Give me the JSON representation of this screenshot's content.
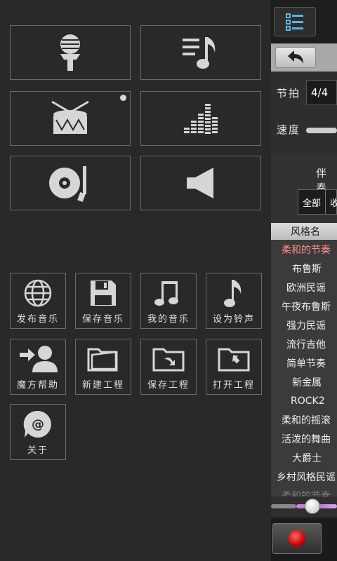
{
  "left_menu": {
    "top_buttons": [
      {
        "icon": "microphone-icon"
      },
      {
        "icon": "playlist-music-icon"
      },
      {
        "icon": "drum-icon",
        "has_indicator": true
      },
      {
        "icon": "equalizer-icon"
      },
      {
        "icon": "turntable-icon"
      },
      {
        "icon": "speaker-icon"
      }
    ],
    "actions": [
      {
        "icon": "globe-icon",
        "label": "发布音乐"
      },
      {
        "icon": "floppy-disk-icon",
        "label": "保存音乐"
      },
      {
        "icon": "double-note-icon",
        "label": "我的音乐"
      },
      {
        "icon": "single-note-icon",
        "label": "设为铃声"
      },
      {
        "icon": "user-arrow-icon",
        "label": "魔方帮助"
      },
      {
        "icon": "open-folder-icon",
        "label": "新建工程"
      },
      {
        "icon": "folder-save-icon",
        "label": "保存工程"
      },
      {
        "icon": "folder-open-icon",
        "label": "打开工程"
      },
      {
        "icon": "at-sign-icon",
        "label": "关于"
      }
    ]
  },
  "right_panel": {
    "menu_icon": "list-icon",
    "back_icon": "back-arrow-icon",
    "beat_label": "节拍",
    "beat_value": "4/4",
    "speed_label": "速度",
    "accompaniment_label": "伴奏",
    "tabs": [
      "全部",
      "收"
    ],
    "list_header": "风格名",
    "styles": [
      "柔和的节奏",
      "布鲁斯",
      "欧洲民谣",
      "午夜布鲁斯",
      "强力民谣",
      "流行吉他",
      "简单节奏",
      "新金属",
      "ROCK2",
      "柔和的摇滚",
      "活泼的舞曲",
      "大爵士",
      "乡村风格民谣",
      "柔和的节奏"
    ],
    "selected_style_index": 0,
    "slider_level": 0.35,
    "record_icon": "record-icon",
    "colors": {
      "selected_text": "#ff8e8e",
      "record": "#d00000",
      "slider": "#b46ae0"
    }
  }
}
